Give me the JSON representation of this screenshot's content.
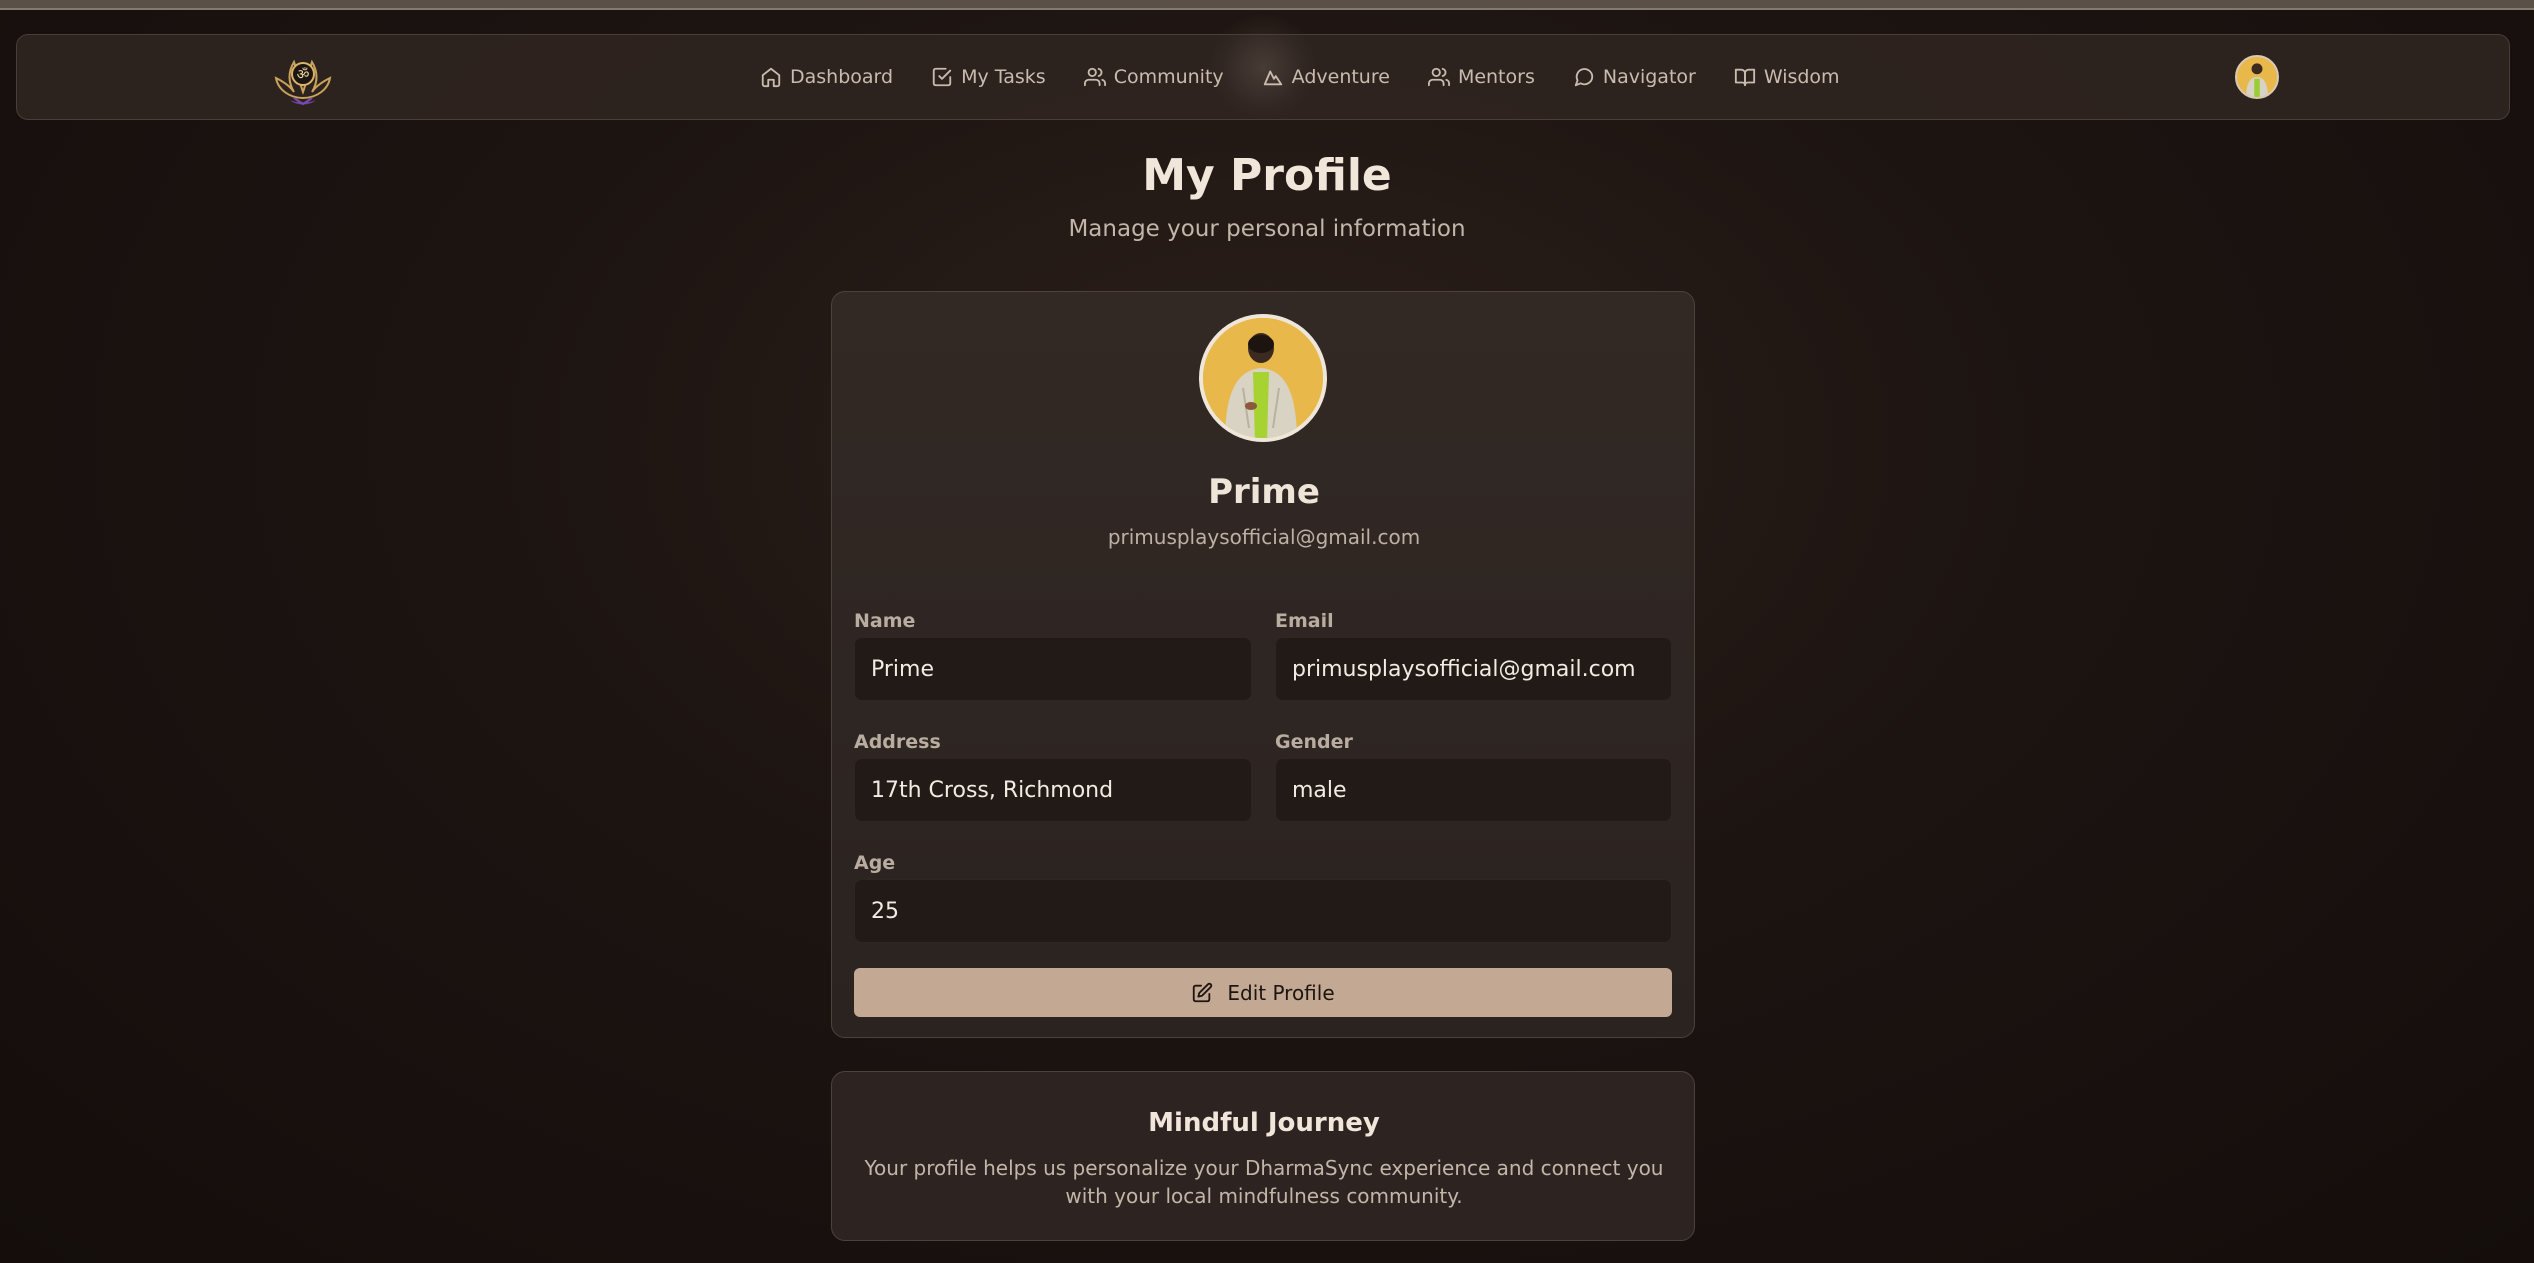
{
  "nav": {
    "items": [
      {
        "label": "Dashboard",
        "icon": "home-icon"
      },
      {
        "label": "My Tasks",
        "icon": "check-square-icon"
      },
      {
        "label": "Community",
        "icon": "users-icon"
      },
      {
        "label": "Adventure",
        "icon": "mountain-icon"
      },
      {
        "label": "Mentors",
        "icon": "users-icon"
      },
      {
        "label": "Navigator",
        "icon": "message-circle-icon"
      },
      {
        "label": "Wisdom",
        "icon": "book-open-icon"
      }
    ],
    "logo_icon": "om-lotus-logo",
    "avatar_icon": "user-avatar"
  },
  "page": {
    "title": "My Profile",
    "subtitle": "Manage your personal information"
  },
  "profile": {
    "name": "Prime",
    "email": "primusplaysofficial@gmail.com",
    "fields": {
      "name_label": "Name",
      "name_value": "Prime",
      "email_label": "Email",
      "email_value": "primusplaysofficial@gmail.com",
      "address_label": "Address",
      "address_value": "17th Cross, Richmond",
      "gender_label": "Gender",
      "gender_value": "male",
      "age_label": "Age",
      "age_value": "25"
    },
    "edit_button_label": "Edit Profile"
  },
  "journey": {
    "title": "Mindful Journey",
    "text": "Your profile helps us personalize your DharmaSync experience and connect you with your local mindfulness community."
  },
  "colors": {
    "background": "#1c1411",
    "card": "#2f2623",
    "input": "#211a17",
    "button": "#c3a993",
    "avatar_bg": "#e9b84a"
  }
}
